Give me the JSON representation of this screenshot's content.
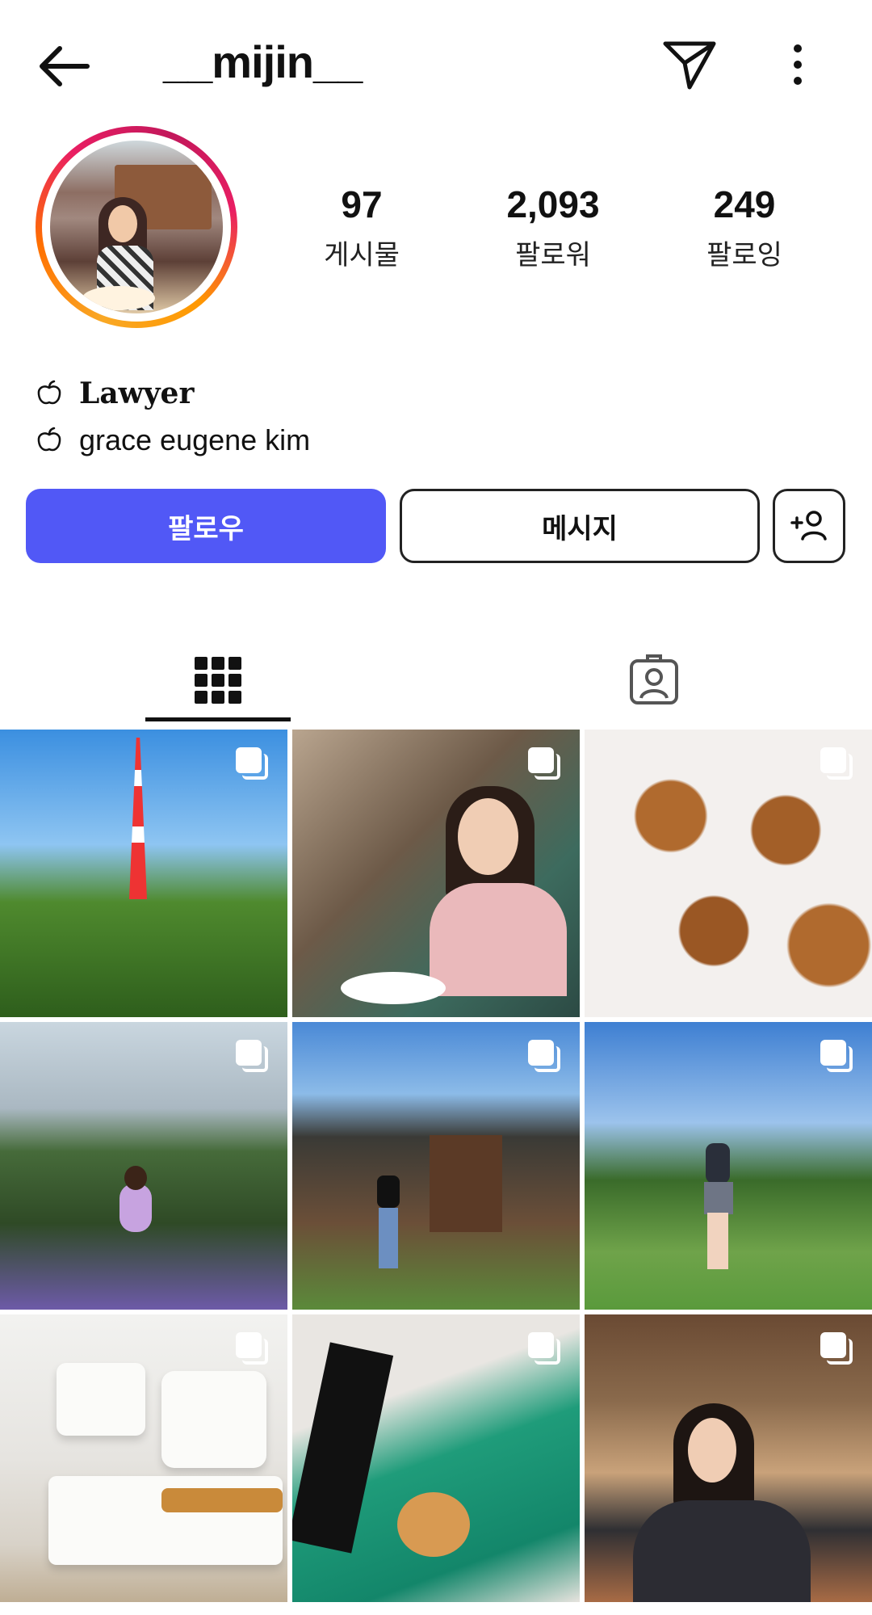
{
  "header": {
    "username": "__mijin__",
    "back_icon": "arrow-left-icon",
    "send_icon": "paper-plane-icon",
    "more_icon": "more-vertical-icon"
  },
  "profile": {
    "stats": [
      {
        "value": "97",
        "label": "게시물"
      },
      {
        "value": "2,093",
        "label": "팔로워"
      },
      {
        "value": "249",
        "label": "팔로잉"
      }
    ],
    "bio": [
      {
        "icon": "apple-icon",
        "text": "Lawyer"
      },
      {
        "icon": "apple-icon",
        "text": "grace eugene kim"
      }
    ]
  },
  "actions": {
    "follow_label": "팔로우",
    "message_label": "메시지",
    "follow_color": "#5158f6"
  },
  "tabs": [
    {
      "name": "posts-grid",
      "icon": "grid-icon",
      "active": true
    },
    {
      "name": "tagged",
      "icon": "tagged-person-icon",
      "active": false
    }
  ],
  "posts": [
    {
      "subject": "Tokyo Tower among trees",
      "multiple": true
    },
    {
      "subject": "Woman dining at marble bar",
      "multiple": true
    },
    {
      "subject": "Chestnut pastries with googly eyes",
      "multiple": true
    },
    {
      "subject": "Woman in field of purple flowers",
      "multiple": true
    },
    {
      "subject": "Woman in front of stone building with palms",
      "multiple": true
    },
    {
      "subject": "Golfer on green course",
      "multiple": true
    },
    {
      "subject": "Plated desserts on white dish",
      "multiple": true
    },
    {
      "subject": "Photo strip and green cake",
      "multiple": true
    },
    {
      "subject": "Woman seated in restaurant",
      "multiple": true
    }
  ]
}
